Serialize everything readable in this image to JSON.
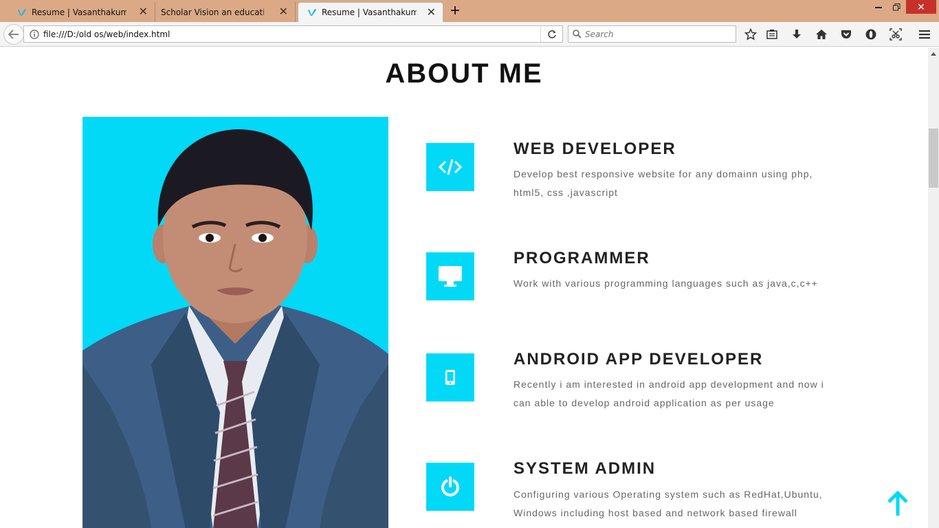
{
  "browser": {
    "tabs": [
      {
        "title": "Resume | Vasanthakumar",
        "active": false
      },
      {
        "title": "Scholar Vision an education Car",
        "active": false
      },
      {
        "title": "Resume | Vasanthakumar",
        "active": true
      }
    ],
    "url": "file:///D:/old os/web/index.html",
    "search_placeholder": "Search"
  },
  "page": {
    "section_title": "ABOUT ME",
    "accent_color": "#01d9f7",
    "skills": [
      {
        "icon": "code-icon",
        "title": "WEB DEVELOPER",
        "description": "Develop best responsive website for any domainn using php, html5, css ,javascript"
      },
      {
        "icon": "desktop-icon",
        "title": "PROGRAMMER",
        "description": "Work with various programming languages such as java,c,c++"
      },
      {
        "icon": "mobile-icon",
        "title": "ANDROID APP DEVELOPER",
        "description": "Recently i am interested in android app development and now i can able to develop android application as per usage"
      },
      {
        "icon": "power-icon",
        "title": "SYSTEM ADMIN",
        "description": "Configuring various Operating system such as RedHat,Ubuntu, Windows including host based and network based firewall"
      }
    ]
  }
}
